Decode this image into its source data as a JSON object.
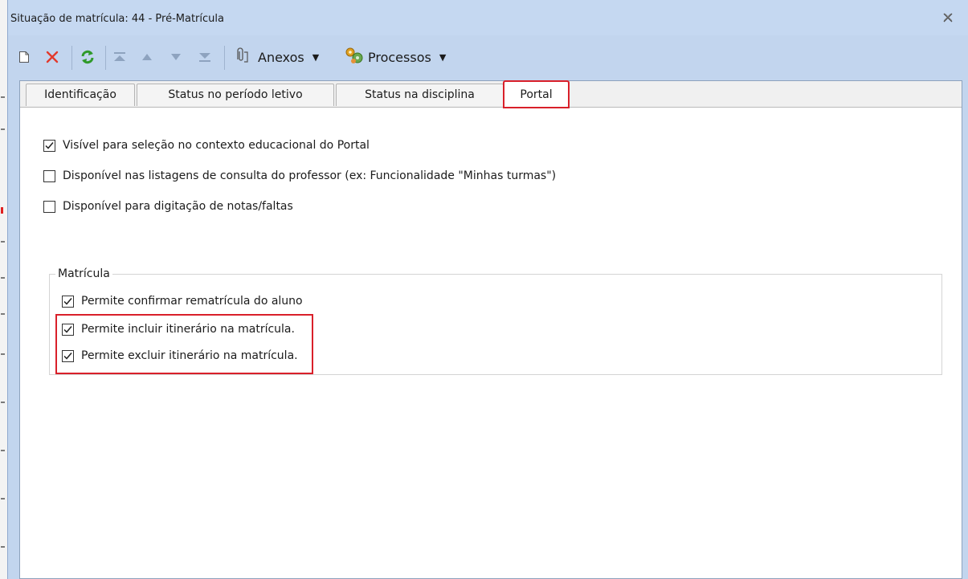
{
  "window": {
    "title": "Situação de matrícula: 44 - Pré-Matrícula",
    "close_icon": "close-icon"
  },
  "toolbar": {
    "new_icon": "new-document-icon",
    "delete_icon": "delete-x-icon",
    "refresh_icon": "refresh-icon",
    "first_icon": "first-record-icon",
    "prev_icon": "previous-record-icon",
    "next_icon": "next-record-icon",
    "last_icon": "last-record-icon",
    "attachments_label": "Anexos",
    "attachments_icon": "paperclip-icon",
    "processes_label": "Processos",
    "processes_icon": "gears-icon"
  },
  "tabs": [
    {
      "label": "Identificação",
      "active": false
    },
    {
      "label": "Status no período letivo",
      "active": false
    },
    {
      "label": "Status na disciplina",
      "active": false
    },
    {
      "label": "Portal",
      "active": true
    }
  ],
  "portal": {
    "options": [
      {
        "label": "Visível para seleção no contexto educacional do Portal",
        "checked": true
      },
      {
        "label": "Disponível nas listagens de consulta do professor (ex: Funcionalidade \"Minhas turmas\")",
        "checked": false
      },
      {
        "label": "Disponível para digitação de notas/faltas",
        "checked": false
      }
    ],
    "matricula": {
      "legend": "Matrícula",
      "options": [
        {
          "label": "Permite confirmar rematrícula do aluno",
          "checked": true
        },
        {
          "label": "Permite incluir itinerário na matrícula.",
          "checked": true
        },
        {
          "label": "Permite excluir itinerário na matrícula.",
          "checked": true
        }
      ]
    }
  },
  "colors": {
    "highlight": "#d9202a",
    "window_frame": "#c2d5ee"
  }
}
